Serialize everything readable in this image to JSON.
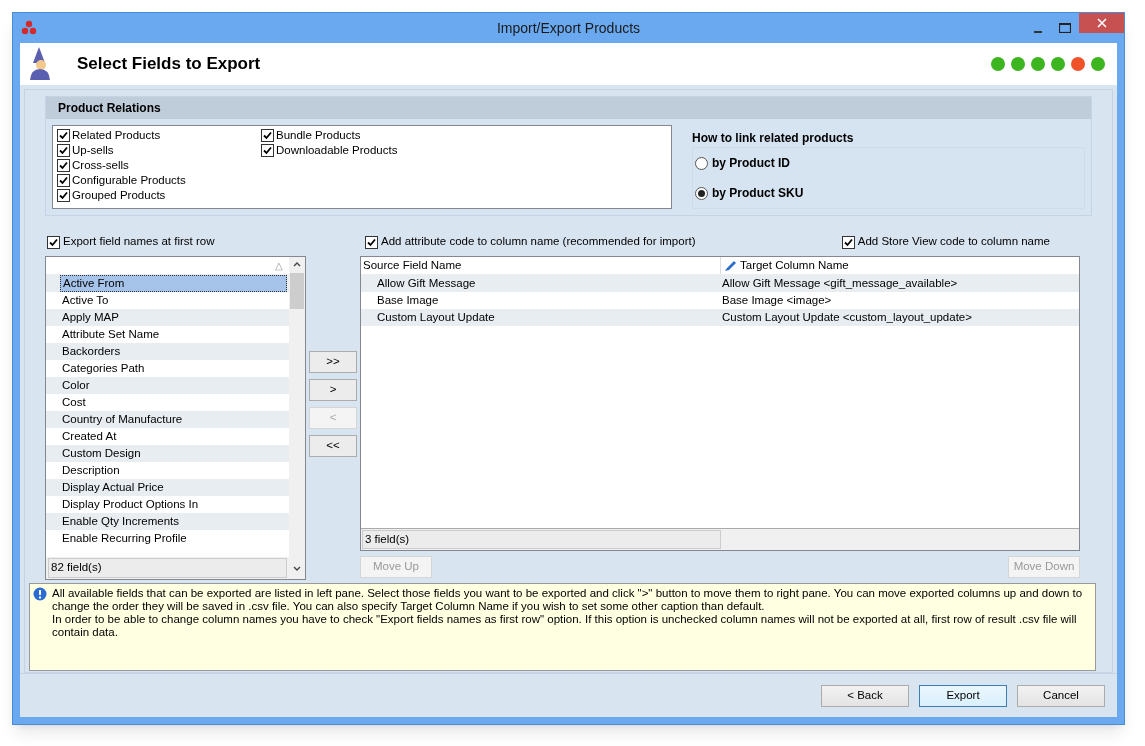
{
  "window": {
    "title": "Import/Export Products"
  },
  "header": {
    "title": "Select Fields to Export",
    "steps": [
      {
        "color": "#3cb521"
      },
      {
        "color": "#3cb521"
      },
      {
        "color": "#3cb521"
      },
      {
        "color": "#3cb521"
      },
      {
        "color": "#f0522a"
      },
      {
        "color": "#3cb521"
      }
    ]
  },
  "product_relations": {
    "title": "Product Relations",
    "checkboxes": [
      {
        "label": "Related Products",
        "checked": true
      },
      {
        "label": "Up-sells",
        "checked": true
      },
      {
        "label": "Cross-sells",
        "checked": true
      },
      {
        "label": "Configurable Products",
        "checked": true
      },
      {
        "label": "Grouped Products",
        "checked": true
      },
      {
        "label": "Bundle Products",
        "checked": true
      },
      {
        "label": "Downloadable Products",
        "checked": true
      }
    ],
    "link_title": "How to link related products",
    "link_options": [
      {
        "label": "by Product ID",
        "selected": false
      },
      {
        "label": "by Product SKU",
        "selected": true
      }
    ]
  },
  "options": [
    {
      "label": "Export field names at first row",
      "checked": true
    },
    {
      "label": "Add attribute code to column name (recommended for import)",
      "checked": true
    },
    {
      "label": "Add Store View code to column name",
      "checked": true
    }
  ],
  "available_fields": {
    "sort_mark": "△",
    "items": [
      {
        "label": "Active From",
        "selected": true
      },
      {
        "label": "Active To",
        "selected": false
      },
      {
        "label": "Apply MAP",
        "selected": false
      },
      {
        "label": "Attribute Set Name",
        "selected": false
      },
      {
        "label": "Backorders",
        "selected": false
      },
      {
        "label": "Categories Path",
        "selected": false
      },
      {
        "label": "Color",
        "selected": false
      },
      {
        "label": "Cost",
        "selected": false
      },
      {
        "label": "Country of Manufacture",
        "selected": false
      },
      {
        "label": "Created At",
        "selected": false
      },
      {
        "label": "Custom Design",
        "selected": false
      },
      {
        "label": "Description",
        "selected": false
      },
      {
        "label": "Display Actual Price",
        "selected": false
      },
      {
        "label": "Display Product Options In",
        "selected": false
      },
      {
        "label": "Enable Qty Increments",
        "selected": false
      },
      {
        "label": "Enable Recurring Profile",
        "selected": false
      }
    ],
    "footer": "82 field(s)"
  },
  "move_buttons": [
    {
      "label": ">>",
      "disabled": false
    },
    {
      "label": ">",
      "disabled": false
    },
    {
      "label": "<",
      "disabled": true
    },
    {
      "label": "<<",
      "disabled": false
    }
  ],
  "export_table": {
    "columns": [
      "Source Field Name",
      "Target Column Name"
    ],
    "rows": [
      [
        "Allow Gift Message",
        "Allow Gift Message <gift_message_available>"
      ],
      [
        "Base Image",
        "Base Image <image>"
      ],
      [
        "Custom Layout Update",
        "Custom Layout Update <custom_layout_update>"
      ]
    ],
    "footer": "3 field(s)"
  },
  "order_buttons": [
    {
      "label": "Move Up",
      "disabled": true
    },
    {
      "label": "Move Down",
      "disabled": true
    }
  ],
  "info": [
    "All available fields that can be exported are listed in left pane. Select those fields you want to be exported and click \">\" button to move them to right pane. You can move exported columns up and down to change the order they will be saved in .csv file. You can also specify Target Column Name if you wish to set some other caption than default.",
    "In order to be able to change column names you have to check \"Export fields names as first row\" option. If this option is unchecked column names will not be exported at all, first row of result .csv file will contain data."
  ],
  "buttons": [
    {
      "label": "< Back",
      "selected": false
    },
    {
      "label": "Export",
      "selected": true
    },
    {
      "label": "Cancel",
      "selected": false
    }
  ]
}
